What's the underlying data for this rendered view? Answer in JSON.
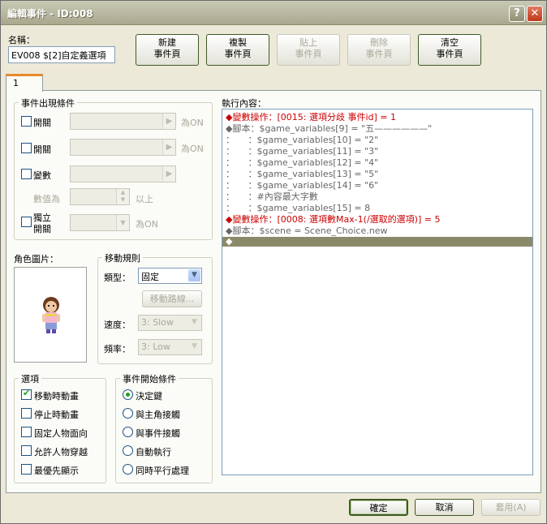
{
  "window": {
    "title": "編輯事件 - ID:008",
    "help": "?",
    "close": "✕"
  },
  "name_label": "名稱：",
  "name_value": "EV008 $[2]自定義選項",
  "toolbar": [
    {
      "label1": "新建",
      "label2": "事件頁",
      "disabled": false
    },
    {
      "label1": "複製",
      "label2": "事件頁",
      "disabled": false
    },
    {
      "label1": "貼上",
      "label2": "事件頁",
      "disabled": true
    },
    {
      "label1": "刪除",
      "label2": "事件頁",
      "disabled": true
    },
    {
      "label1": "清空",
      "label2": "事件頁",
      "disabled": false
    }
  ],
  "tab_label": "1",
  "conditions": {
    "title": "事件出現條件",
    "switch1": "開關",
    "switch1_suffix": "為ON",
    "switch2": "開關",
    "switch2_suffix": "為ON",
    "variable": "變數",
    "value_label": "數值為",
    "value_suffix": "以上",
    "self_switch1": "獨立",
    "self_switch2": "開關",
    "self_suffix": "為ON"
  },
  "graphic_label": "角色圖片：",
  "movement": {
    "title": "移動規則",
    "type_label": "類型：",
    "type_value": "固定",
    "route_button": "移動路線...",
    "speed_label": "速度：",
    "speed_value": "3: Slow",
    "freq_label": "頻率：",
    "freq_value": "3: Low"
  },
  "options": {
    "title": "選項",
    "items": [
      {
        "label": "移動時動畫",
        "checked": true
      },
      {
        "label": "停止時動畫",
        "checked": false
      },
      {
        "label": "固定人物面向",
        "checked": false
      },
      {
        "label": "允許人物穿越",
        "checked": false
      },
      {
        "label": "最優先顯示",
        "checked": false
      }
    ]
  },
  "trigger": {
    "title": "事件開始條件",
    "items": [
      {
        "label": "決定鍵",
        "selected": true
      },
      {
        "label": "與主角接觸",
        "selected": false
      },
      {
        "label": "與事件接觸",
        "selected": false
      },
      {
        "label": "自動執行",
        "selected": false
      },
      {
        "label": "同時平行處理",
        "selected": false
      }
    ]
  },
  "contents_label": "執行內容：",
  "commands": [
    {
      "text": "◆變數操作：[0015: 選項分歧 事件id] = 1",
      "style": "red"
    },
    {
      "text": "◆腳本：$game_variables[9] = \"五——————\"",
      "style": "gline"
    },
    {
      "text": "：　　：$game_variables[10] = \"2\"",
      "style": "gline"
    },
    {
      "text": "：　　：$game_variables[11] = \"3\"",
      "style": "gline"
    },
    {
      "text": "：　　：$game_variables[12] = \"4\"",
      "style": "gline"
    },
    {
      "text": "：　　：$game_variables[13] = \"5\"",
      "style": "gline"
    },
    {
      "text": "：　　：$game_variables[14] = \"6\"",
      "style": "gline"
    },
    {
      "text": "：　　：#內容最大字數",
      "style": "gline"
    },
    {
      "text": "：　　：$game_variables[15] = 8",
      "style": "gline"
    },
    {
      "text": "◆變數操作：[0008: 選項數Max-1(/選取的選項)] = 5",
      "style": "red"
    },
    {
      "text": "◆腳本：$scene = Scene_Choice.new",
      "style": "gline"
    },
    {
      "text": "◆",
      "style": "sel"
    }
  ],
  "footer": {
    "ok": "確定",
    "cancel": "取消",
    "apply": "套用(A)"
  }
}
